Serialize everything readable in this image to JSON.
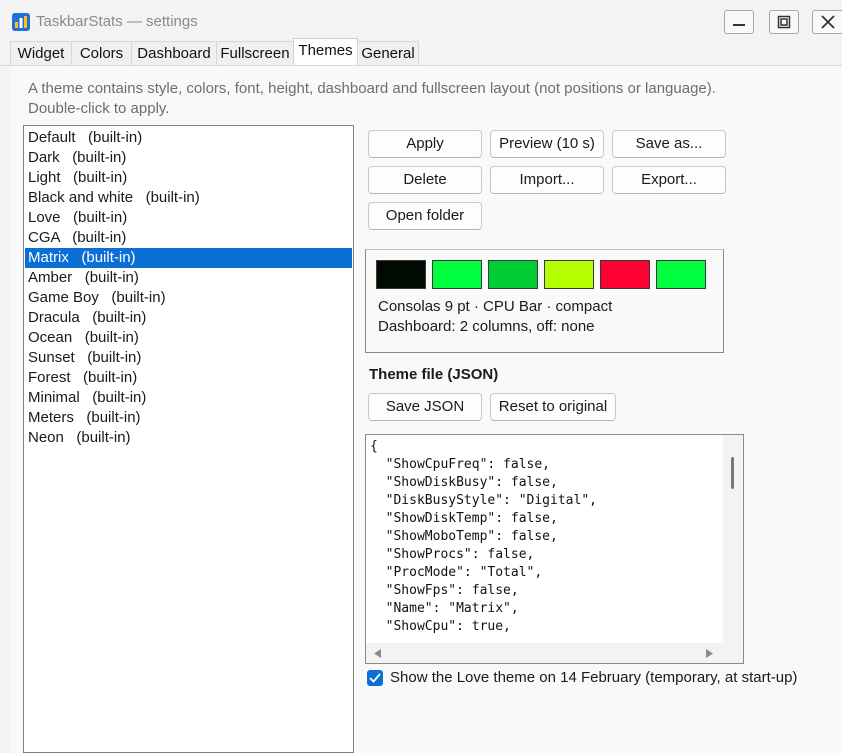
{
  "window": {
    "title": "TaskbarStats — settings",
    "app_icon": "bar-chart-icon"
  },
  "tabs": [
    {
      "label": "Widget",
      "active": false
    },
    {
      "label": "Colors",
      "active": false
    },
    {
      "label": "Dashboard",
      "active": false
    },
    {
      "label": "Fullscreen",
      "active": false
    },
    {
      "label": "Themes",
      "active": true
    },
    {
      "label": "General",
      "active": false
    }
  ],
  "description": {
    "line1": "A theme contains style, colors, font, height, dashboard and fullscreen layout (not positions or language).",
    "line2": "Double-click to apply."
  },
  "themes": [
    {
      "name": "Default",
      "tag": "(built-in)",
      "selected": false
    },
    {
      "name": "Dark",
      "tag": "(built-in)",
      "selected": false
    },
    {
      "name": "Light",
      "tag": "(built-in)",
      "selected": false
    },
    {
      "name": "Black and white",
      "tag": "(built-in)",
      "selected": false
    },
    {
      "name": "Love",
      "tag": "(built-in)",
      "selected": false
    },
    {
      "name": "CGA",
      "tag": "(built-in)",
      "selected": false
    },
    {
      "name": "Matrix",
      "tag": "(built-in)",
      "selected": true
    },
    {
      "name": "Amber",
      "tag": "(built-in)",
      "selected": false
    },
    {
      "name": "Game Boy",
      "tag": "(built-in)",
      "selected": false
    },
    {
      "name": "Dracula",
      "tag": "(built-in)",
      "selected": false
    },
    {
      "name": "Ocean",
      "tag": "(built-in)",
      "selected": false
    },
    {
      "name": "Sunset",
      "tag": "(built-in)",
      "selected": false
    },
    {
      "name": "Forest",
      "tag": "(built-in)",
      "selected": false
    },
    {
      "name": "Minimal",
      "tag": "(built-in)",
      "selected": false
    },
    {
      "name": "Meters",
      "tag": "(built-in)",
      "selected": false
    },
    {
      "name": "Neon",
      "tag": "(built-in)",
      "selected": false
    }
  ],
  "actions": {
    "apply": "Apply",
    "preview": "Preview (10 s)",
    "save_as": "Save as...",
    "delete": "Delete",
    "import": "Import...",
    "export": "Export...",
    "open_folder": "Open folder"
  },
  "preview": {
    "swatches": [
      "#000a00",
      "#00ff41",
      "#00cc33",
      "#b3ff00",
      "#ff0033",
      "#00ff41"
    ],
    "line1": "Consolas 9 pt · CPU Bar · compact",
    "line2": "Dashboard: 2 columns, off: none"
  },
  "theme_file": {
    "heading": "Theme file (JSON)",
    "save_json": "Save JSON",
    "reset": "Reset to original",
    "lines": [
      "{",
      "  \"ShowCpuFreq\": false,",
      "  \"ShowDiskBusy\": false,",
      "  \"DiskBusyStyle\": \"Digital\",",
      "  \"ShowDiskTemp\": false,",
      "  \"ShowMoboTemp\": false,",
      "  \"ShowProcs\": false,",
      "  \"ProcMode\": \"Total\",",
      "  \"ShowFps\": false,",
      "  \"Name\": \"Matrix\",",
      "  \"ShowCpu\": true,"
    ]
  },
  "love_option": {
    "checked": true,
    "label": "Show the Love theme on 14 February (temporary, at start-up)"
  },
  "colors": {
    "accent": "#0b6fd6"
  }
}
